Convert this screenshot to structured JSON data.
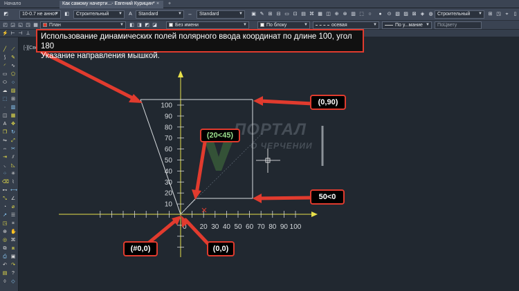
{
  "tabs": [
    {
      "label": "Начало"
    },
    {
      "label": "Как самому начерти...- Евгений Курицин*",
      "active": true,
      "close": "×"
    },
    {
      "label": "+"
    }
  ],
  "toolbar": {
    "annoscale": "10-0.7 не аннот",
    "layer_state": "Строительный",
    "text_style": "Standard",
    "dim_style": "Standard",
    "right_style": "Строительный",
    "layer": "План",
    "linetype_bylayer": "Без имени",
    "lineweight": "По блоку",
    "plotstyle": "осевая",
    "linetype2": "По у...мание",
    "color": "ПоЦвету"
  },
  "viewport_label": "[-][Сверху][2D-каркас]",
  "banner": {
    "line1": "Использование динамических полей полярного ввода координат по длине 100, угол 180",
    "line2": "Указание направления мышкой."
  },
  "callouts": {
    "top_right": "(0,90)",
    "mid_right": "50<0",
    "bottom_left": "(#0,0)",
    "bottom_center": "(0,0)"
  },
  "dynamic_input": "(20<45)",
  "axis": {
    "y_ticks": [
      "100",
      "90",
      "80",
      "70",
      "60",
      "50",
      "40",
      "30",
      "20",
      "10"
    ],
    "x_ticks": [
      "20",
      "30",
      "40",
      "50",
      "60",
      "70",
      "80",
      "90",
      "100"
    ],
    "x_origin_fragment": "0"
  },
  "watermark": {
    "line1": "ПОРТАЛ",
    "line2": "О ЧЕРЧЕНИИ"
  },
  "colors": {
    "accent_red": "#e13b2e",
    "axis_yellow": "#e8e04a",
    "dyn_green": "#9be08d"
  }
}
